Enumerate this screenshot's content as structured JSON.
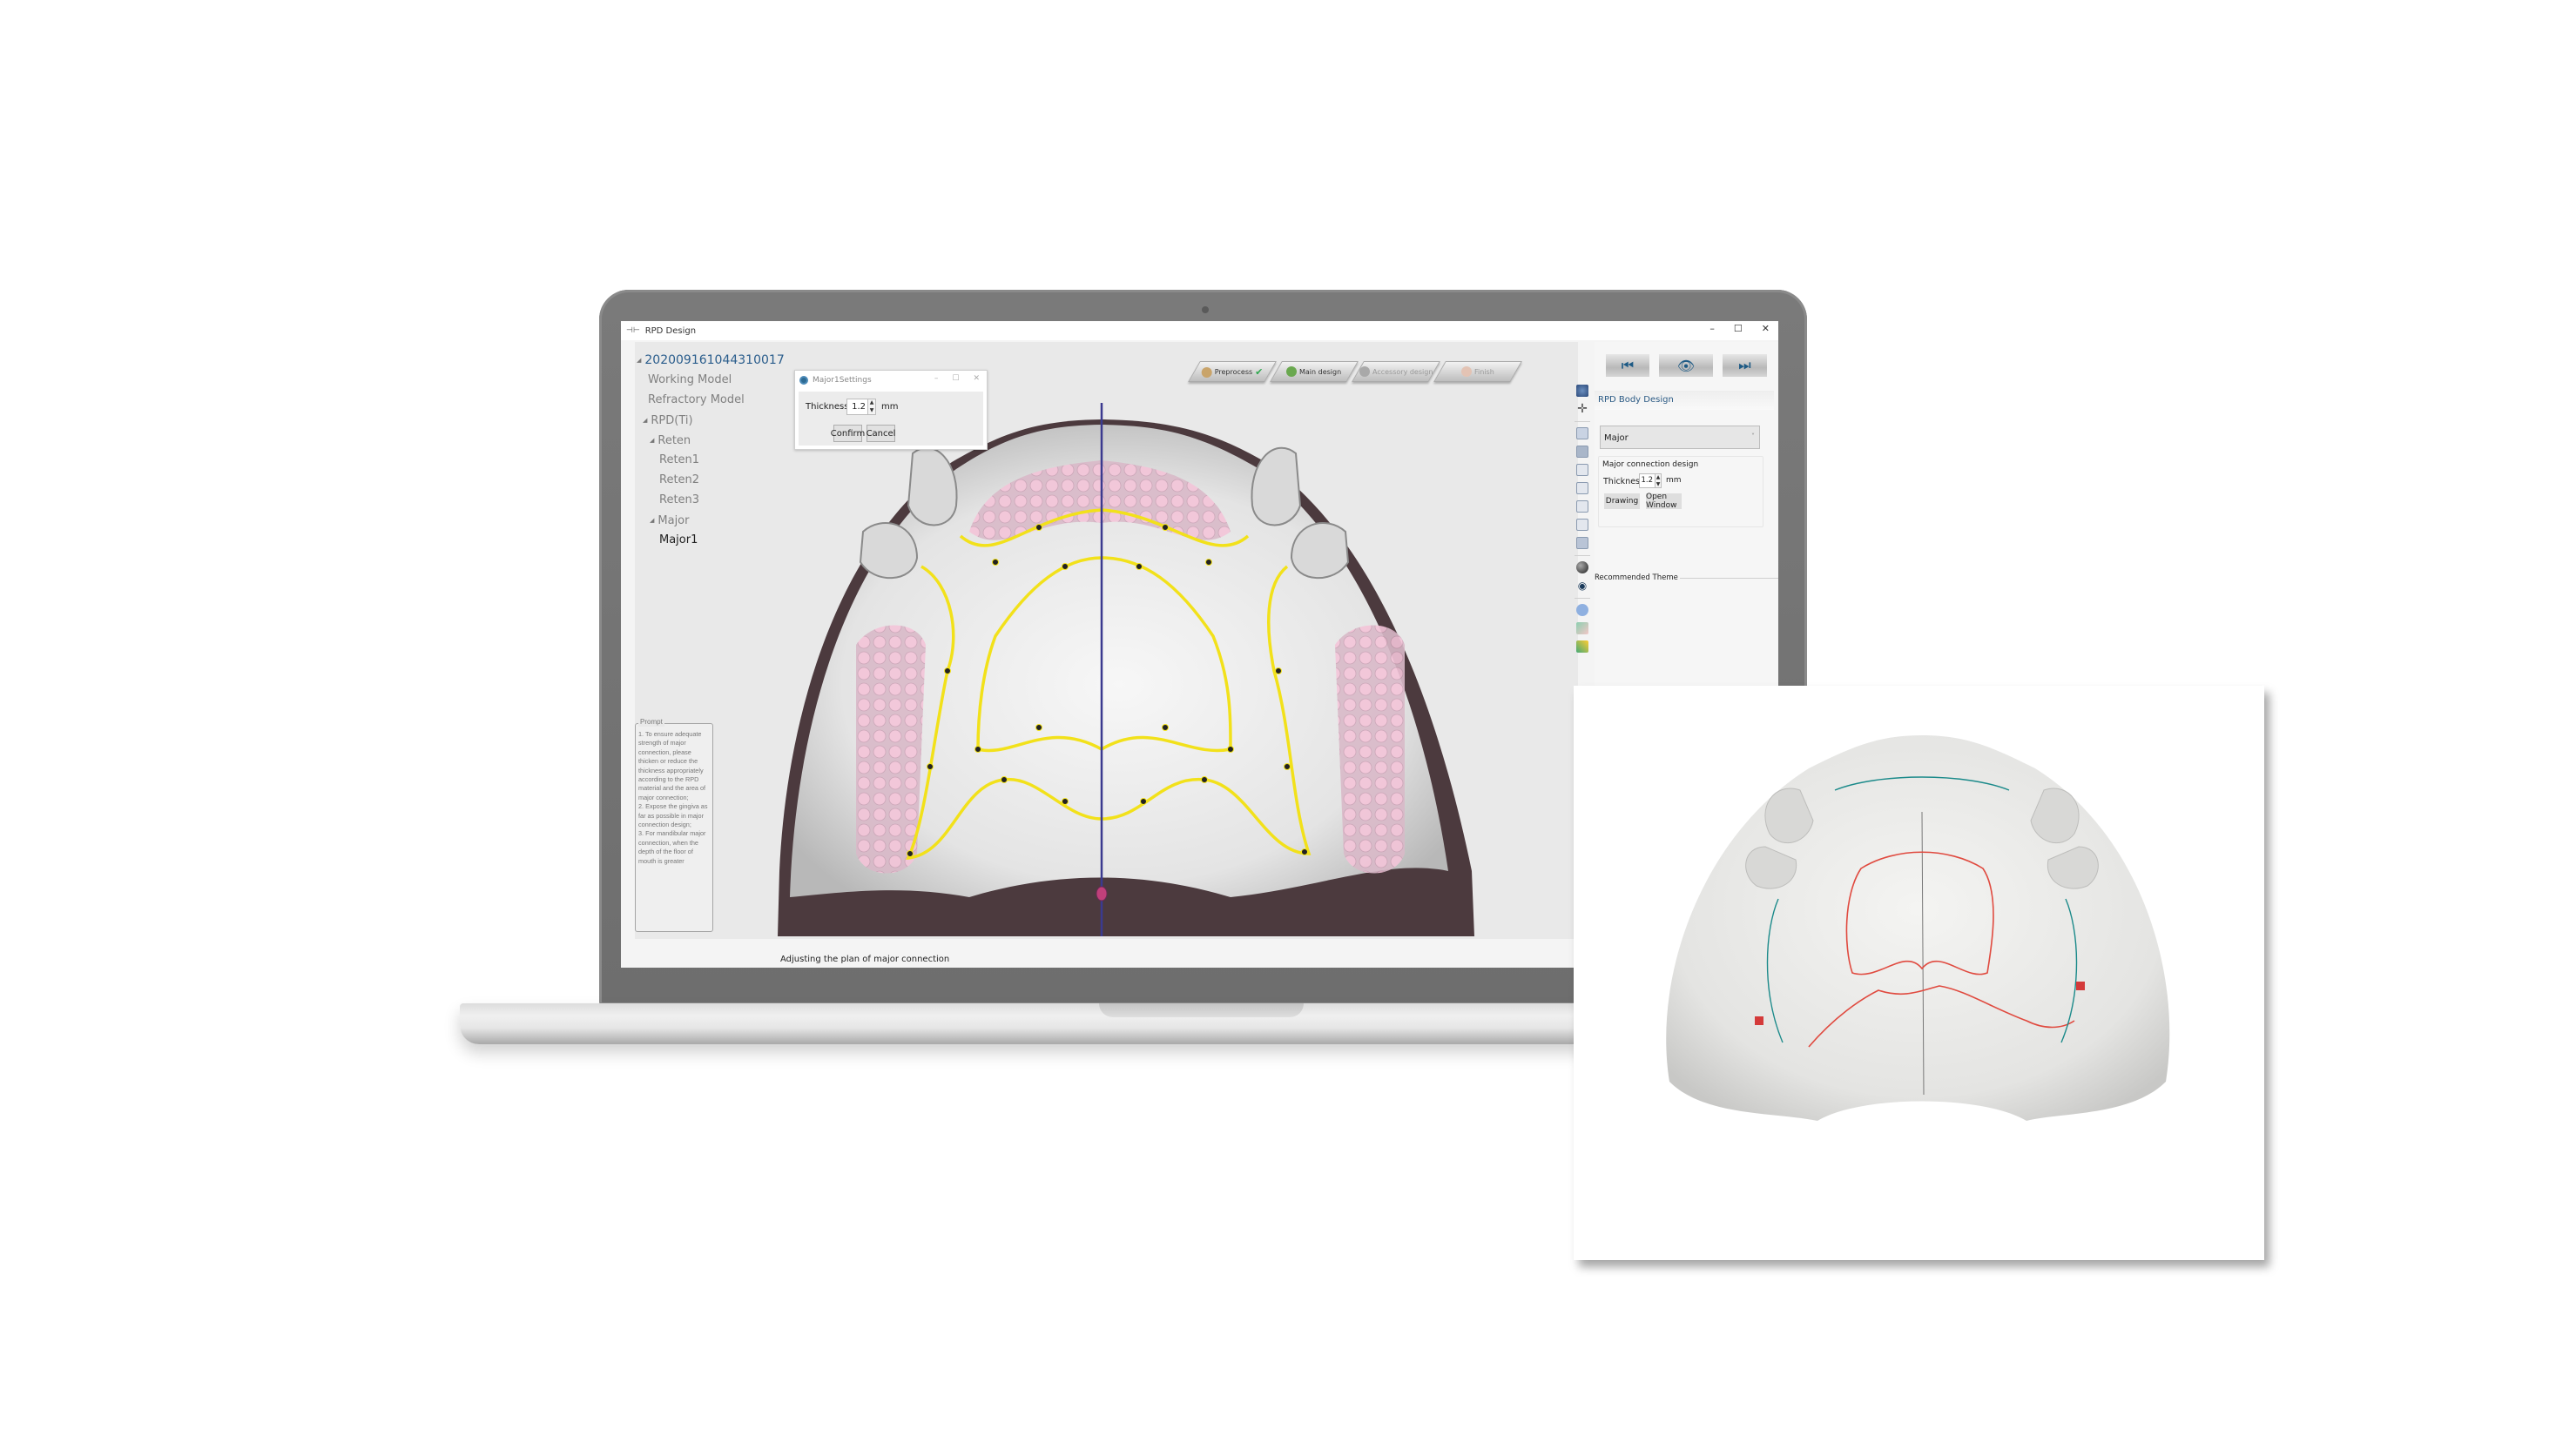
{
  "window": {
    "title": "RPD Design",
    "controls": [
      "–",
      "☐",
      "✕"
    ]
  },
  "tree": {
    "root": "202009161044310017",
    "items": [
      {
        "label": "Working Model",
        "level": 1
      },
      {
        "label": "Refractory Model",
        "level": 1
      },
      {
        "label": "RPD(Ti)",
        "level": 1,
        "expanded": true
      },
      {
        "label": "Reten",
        "level": 2,
        "expanded": true
      },
      {
        "label": "Reten1",
        "level": 3
      },
      {
        "label": "Reten2",
        "level": 3
      },
      {
        "label": "Reten3",
        "level": 3
      },
      {
        "label": "Major",
        "level": 2,
        "expanded": true
      },
      {
        "label": "Major1",
        "level": 3,
        "selected": true
      }
    ]
  },
  "steps": [
    {
      "label": "Preprocess",
      "icon": "preprocess-icon",
      "done": true
    },
    {
      "label": "Main design",
      "icon": "main-design-icon"
    },
    {
      "label": "Accessory design",
      "icon": "accessory-icon",
      "disabled": true
    },
    {
      "label": "Finish",
      "icon": "finish-icon",
      "disabled": true
    }
  ],
  "dialog": {
    "title": "Major1Settings",
    "thickness_label": "Thickness:",
    "thickness_value": "1.2",
    "unit": "mm",
    "confirm": "Confirm",
    "cancel": "Cancel"
  },
  "prompt": {
    "legend": "Prompt",
    "text": "1. To ensure adequate strength of major connection, please thicken or reduce the thickness appropriately according to the RPD material and the area of major connection;\n2. Expose the gingiva as far as possible in major connection design;\n3. For mandibular major connection, when the depth of the floor of mouth is greater"
  },
  "status": "Adjusting the plan of major connection",
  "right_panel": {
    "nav": {
      "prev": "previous-step",
      "view": "view",
      "next": "next-step"
    },
    "section": "RPD Body Design",
    "select_value": "Major",
    "group_title": "Major connection design",
    "thickness_label": "Thickness",
    "thickness_value": "1.2",
    "unit": "mm",
    "drawing": "Drawing",
    "open_window": "Open Window",
    "theme": "Recommended Theme"
  },
  "colors": {
    "accent": "#2a5d8c",
    "outline": "#f2e11a",
    "midline": "#3b3a8f",
    "mesh": "#e8b6cf",
    "pencil_red": "#e04a3f",
    "pencil_teal": "#1b8a8a"
  }
}
